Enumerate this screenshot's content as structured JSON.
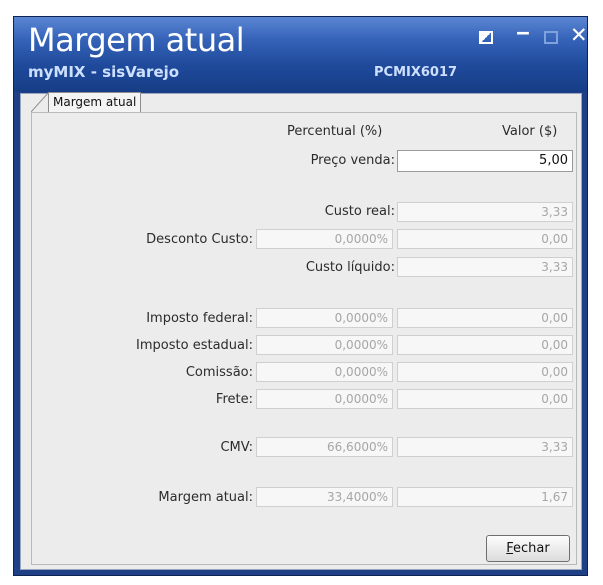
{
  "window": {
    "title": "Margem atual",
    "subtitle": "myMIX - sisVarejo",
    "code": "PCMIX6017"
  },
  "tab": {
    "label": "Margem atual"
  },
  "headers": {
    "percent": "Percentual (%)",
    "value": "Valor ($)"
  },
  "rows": {
    "preco_venda": {
      "label": "Preço venda:",
      "value": "5,00"
    },
    "custo_real": {
      "label": "Custo real:",
      "value": "3,33"
    },
    "desconto_custo": {
      "label": "Desconto Custo:",
      "percent": "0,0000%",
      "value": "0,00"
    },
    "custo_liquido": {
      "label": "Custo líquido:",
      "value": "3,33"
    },
    "imposto_federal": {
      "label": "Imposto federal:",
      "percent": "0,0000%",
      "value": "0,00"
    },
    "imposto_estadual": {
      "label": "Imposto estadual:",
      "percent": "0,0000%",
      "value": "0,00"
    },
    "comissao": {
      "label": "Comissão:",
      "percent": "0,0000%",
      "value": "0,00"
    },
    "frete": {
      "label": "Frete:",
      "percent": "0,0000%",
      "value": "0,00"
    },
    "cmv": {
      "label": "CMV:",
      "percent": "66,6000%",
      "value": "3,33"
    },
    "margem_atual": {
      "label": "Margem atual:",
      "percent": "33,4000%",
      "value": "1,67"
    }
  },
  "buttons": {
    "close_label": "Fechar"
  },
  "icons": {
    "restore": "restore-icon",
    "minimize": "minimize-icon",
    "maximize": "maximize-icon",
    "close": "close-icon"
  },
  "colors": {
    "titlebar": "#1f4a9b",
    "window_border": "#1f3f86",
    "client_bg": "#ececec"
  }
}
